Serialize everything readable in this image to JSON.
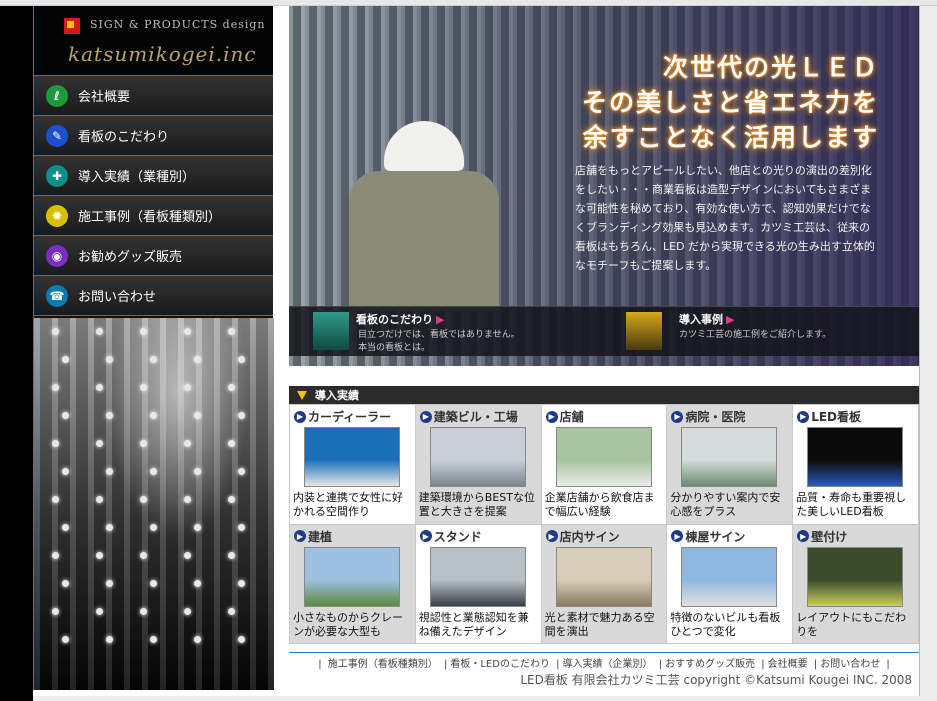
{
  "brand": {
    "tagline": "SIGN & PRODUCTS design",
    "company": "katsumikogei.inc"
  },
  "sidebar": {
    "items": [
      {
        "label": "会社概要",
        "icon": "leaf-icon",
        "color": "#1e9a3a"
      },
      {
        "label": "看板のこだわり",
        "icon": "brush-icon",
        "color": "#1e4fd0"
      },
      {
        "label": "導入実績（業種別）",
        "icon": "cross-icon",
        "color": "#0b8f88"
      },
      {
        "label": "施工事例（看板種類別）",
        "icon": "sun-icon",
        "color": "#d8c000"
      },
      {
        "label": "お勧めグッズ販売",
        "icon": "bag-icon",
        "color": "#7a2ec2"
      },
      {
        "label": "お問い合わせ",
        "icon": "phone-icon",
        "color": "#0a7cb0"
      }
    ]
  },
  "hero": {
    "headline1": "次世代の光ＬＥＤ",
    "headline2": "その美しさと省エネ力を",
    "headline3": "余すことなく活用します",
    "description": "店舗をもっとアピールしたい、他店との光りの演出の差別化をしたい・・・商業看板は造型デザインにおいてもさまざまな可能性を秘めており、有効な使い方で、認知効果だけでなくブランディング効果も見込めます。カツミ工芸は、従来の看板はもちろん、LED だから実現できる光の生み出す立体的なモチーフもご提案します。",
    "links": [
      {
        "title": "看板のこだわり",
        "sub1": "目立つだけでは、看板ではありません。",
        "sub2": "本当の看板とは。"
      },
      {
        "title": "導入事例",
        "sub1": "カツミ工芸の施工例をご紹介します。",
        "sub2": ""
      }
    ]
  },
  "cases": {
    "header": "導入実績",
    "items": [
      {
        "title": "カーディーラー",
        "cap": "内装と連携で女性に好かれる空間作り",
        "img": [
          "#1a6fb8",
          "#e8e8e8"
        ]
      },
      {
        "title": "建築ビル・工場",
        "cap": "建築環境からBESTな位置と大きさを提案",
        "img": [
          "#c9cfd6",
          "#7a8590"
        ]
      },
      {
        "title": "店舗",
        "cap": "企業店舗から飲食店まで幅広い経験",
        "img": [
          "#a8c4a0",
          "#eaeaea"
        ]
      },
      {
        "title": "病院・医院",
        "cap": "分かりやすい案内で安心感をプラス",
        "img": [
          "#d6dcdc",
          "#6a8a70"
        ]
      },
      {
        "title": "LED看板",
        "cap": "品質・寿命も重要視した美しいLED看板",
        "img": [
          "#0a0a0a",
          "#2a5ab8"
        ]
      },
      {
        "title": "建植",
        "cap": "小さなものからクレーンが必要な大型も",
        "img": [
          "#9cc0e0",
          "#5a8a40"
        ]
      },
      {
        "title": "スタンド",
        "cap": "視認性と業態認知を兼ね備えたデザイン",
        "img": [
          "#b8c0c8",
          "#3a4048"
        ]
      },
      {
        "title": "店内サイン",
        "cap": "光と素材で魅力ある空間を演出",
        "img": [
          "#d8cdb8",
          "#8a7a60"
        ]
      },
      {
        "title": "棟屋サイン",
        "cap": "特徴のないビルも看板ひとつで変化",
        "img": [
          "#8fb8e0",
          "#e0e0e0"
        ]
      },
      {
        "title": "壁付け",
        "cap": "レイアウトにもこだわりを",
        "img": [
          "#3a4a2a",
          "#c8d060"
        ]
      }
    ]
  },
  "footer": {
    "nav": [
      "施工事例（看板種類別）",
      "看板・LEDのこだわり",
      "導入実績（企業別）",
      "おすすめグッズ販売",
      "会社概要",
      "お問い合わせ"
    ],
    "copyright": "LED看板  有限会社カツミ工芸   copyright ©Katsumi Kougei INC. 2008"
  }
}
